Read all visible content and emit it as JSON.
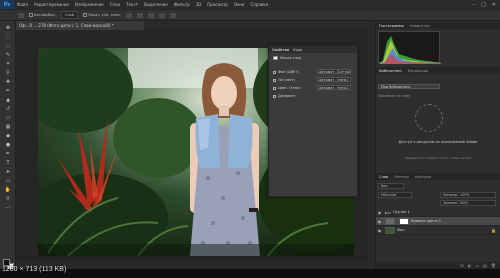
{
  "app": {
    "logo": "Ps"
  },
  "menu": [
    "Файл",
    "Редактирование",
    "Изображение",
    "Слои",
    "Текст",
    "Выделение",
    "Фильтр",
    "3D",
    "Просмотр",
    "Окно",
    "Справка"
  ],
  "window_controls": [
    "–",
    "□",
    "✕"
  ],
  "options": {
    "auto_select_label": "Автовыбор:",
    "auto_select_value": "Слой",
    "show_controls_label": "Показ. упр. элем."
  },
  "document": {
    "tab_title": "Оф...8 ... 278 (Фото дети c 1, Слой-маска/8) *"
  },
  "properties": {
    "tabs": [
      "Свойства",
      "Корр"
    ],
    "subtitle": "Маска слоя",
    "rows": [
      {
        "label": "Фон (ЦВЕТ)",
        "select": "Автомат. (Сетка)"
      },
      {
        "label": "Ли (свет)",
        "select": "Автомат. (тень)"
      },
      {
        "label": "Цвет. (тени)",
        "select": "Автомат. (тень)"
      },
      {
        "label": "Дизеринг",
        "select": ""
      }
    ]
  },
  "panels": {
    "histogram_tabs": [
      "Гистограмма",
      "Навигатор"
    ],
    "libraries_tabs": [
      "Библиотеки",
      "Коррекция"
    ],
    "libraries_dropdown": "Мои библиотеки",
    "libraries_label": "Просмотр по типу",
    "libraries_message": "Доступ к ресурсам из приложений Adobe",
    "libraries_sub": "Перейдите в Creative Cloud, чтобы начать",
    "layers_tabs": [
      "Слои",
      "Каналы",
      "Контуры"
    ],
    "layers_kind": "Вид",
    "layers_blend": "Обычные",
    "layers_opacity": "Непрозр.: 100%",
    "layers_fill": "Заливка: 100%",
    "layers": [
      {
        "name": "Группа 1",
        "type": "group",
        "selected": false
      },
      {
        "name": "Кривые цвета 1",
        "type": "adjustment",
        "selected": true
      },
      {
        "name": "Фон",
        "type": "background",
        "selected": false
      }
    ],
    "layers_footer_icons": [
      "fx",
      "◐",
      "▭",
      "▤",
      "🗑"
    ]
  },
  "caption": "1280 × 713 (113 KB)",
  "colors": {
    "accent": "#31a8ff",
    "panel_bg": "#323232",
    "canvas_bg": "#262626"
  }
}
